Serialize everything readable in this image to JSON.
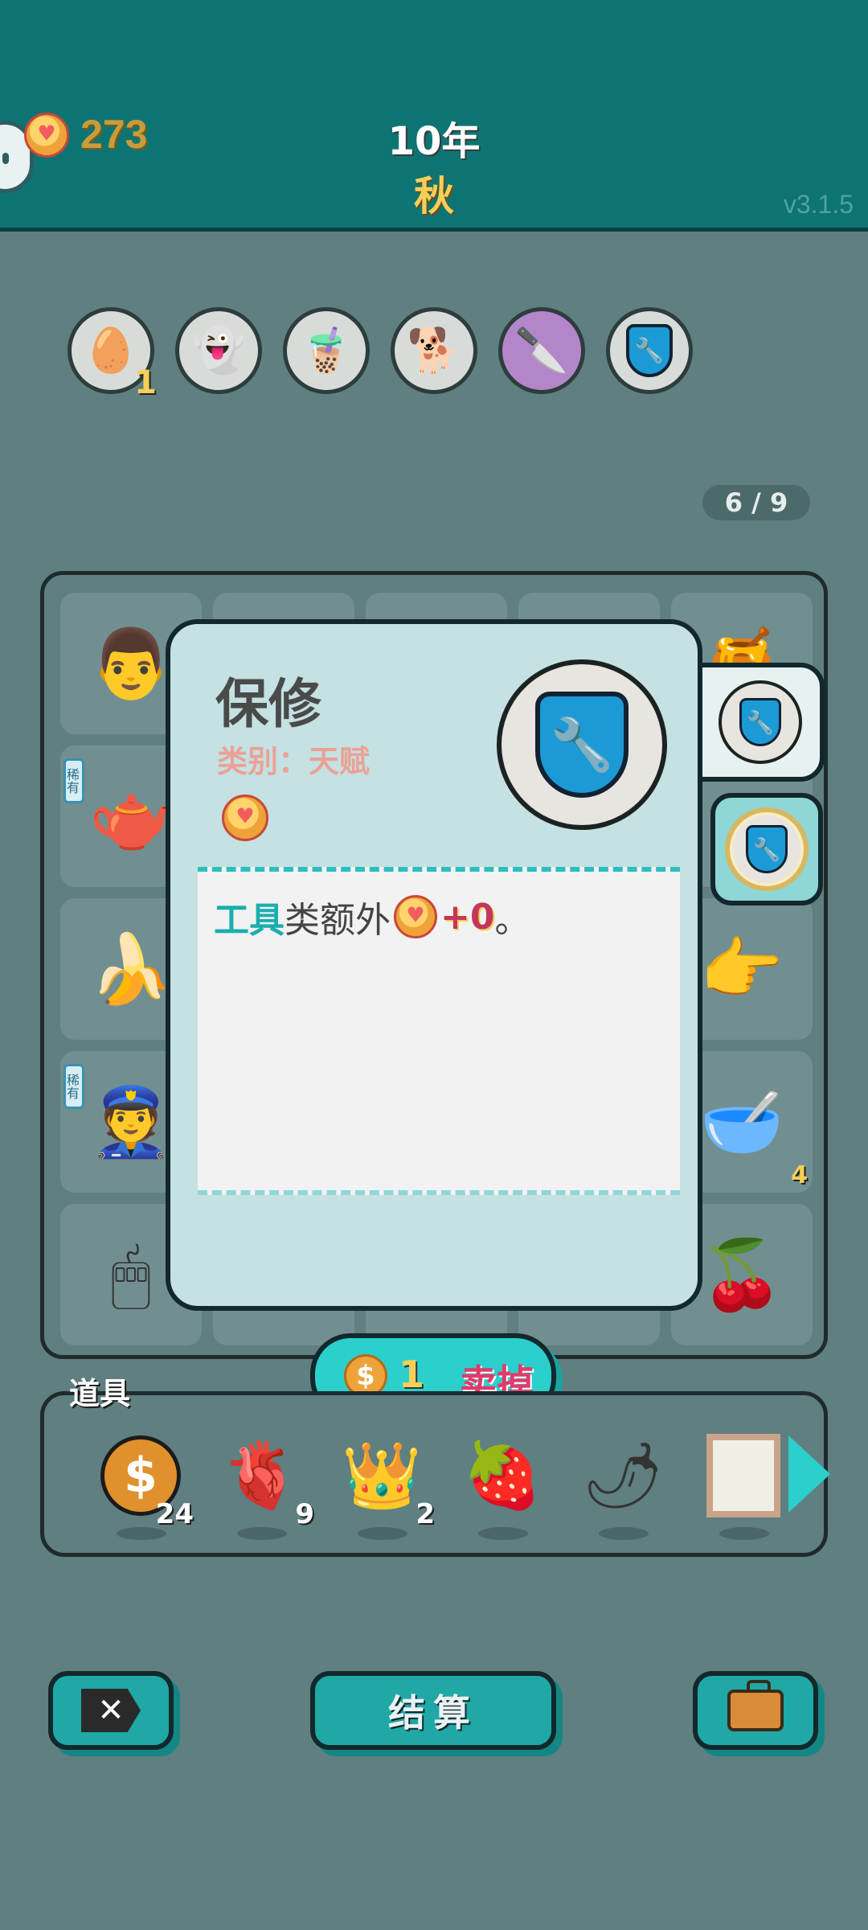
{
  "header": {
    "money": "273",
    "year": "10年",
    "season": "秋",
    "version": "v3.1.5"
  },
  "relics": [
    {
      "name": "egg-tray",
      "glyph": "🥚",
      "count": "1"
    },
    {
      "name": "ghost",
      "glyph": "👻"
    },
    {
      "name": "bubble-tea",
      "glyph": "🧋"
    },
    {
      "name": "dog",
      "glyph": "🐕"
    },
    {
      "name": "cleaver",
      "glyph": "🔪"
    },
    {
      "name": "warranty-shield",
      "glyph": "🔧"
    }
  ],
  "page_indicator": "6 / 9",
  "board": {
    "rare_tag": "稀有",
    "bowl_count": "4"
  },
  "popup": {
    "title": "保修",
    "category": "类别：天赋",
    "desc_keyword": "工具",
    "desc_text": "类额外",
    "desc_plus": "+0",
    "desc_end": "。"
  },
  "sell": {
    "price": "1",
    "label": "卖掉"
  },
  "items": {
    "label": "道具",
    "list": [
      {
        "name": "dollar-coin",
        "count": "24"
      },
      {
        "name": "liver",
        "count": "9"
      },
      {
        "name": "crown",
        "count": "2"
      },
      {
        "name": "strawberry"
      },
      {
        "name": "chili-pepper"
      },
      {
        "name": "picture-frame"
      }
    ]
  },
  "bottom": {
    "settle_label": "结算"
  },
  "colors": {
    "header_bg": "#0e7473",
    "page_bg": "#5f7f80",
    "accent_teal": "#2bd0cc",
    "gold": "#f5cf57",
    "sell_red": "#e13b6b"
  }
}
